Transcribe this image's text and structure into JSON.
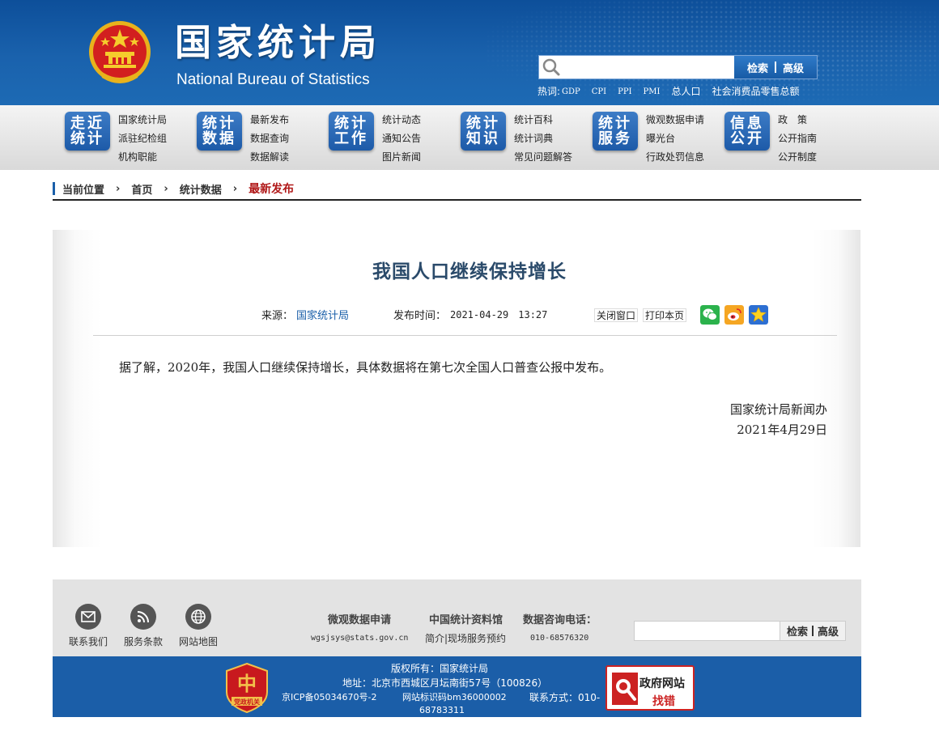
{
  "header": {
    "title_cn": "国家统计局",
    "title_en": "National Bureau of Statistics",
    "search": {
      "placeholder": "",
      "button": "检索",
      "advanced": "高级"
    },
    "hot": {
      "label": "热词:",
      "words": [
        "GDP",
        "CPI",
        "PPI",
        "PMI",
        "总人口",
        "社会消费品零售总额"
      ]
    }
  },
  "nav": [
    {
      "badge": [
        "走近",
        "统计"
      ],
      "links": [
        "国家统计局",
        "派驻纪检组",
        "机构职能"
      ]
    },
    {
      "badge": [
        "统计",
        "数据"
      ],
      "links": [
        "最新发布",
        "数据查询",
        "数据解读"
      ]
    },
    {
      "badge": [
        "统计",
        "工作"
      ],
      "links": [
        "统计动态",
        "通知公告",
        "图片新闻"
      ]
    },
    {
      "badge": [
        "统计",
        "知识"
      ],
      "links": [
        "统计百科",
        "统计词典",
        "常见问题解答"
      ]
    },
    {
      "badge": [
        "统计",
        "服务"
      ],
      "links": [
        "微观数据申请",
        "曝光台",
        "行政处罚信息"
      ]
    },
    {
      "badge": [
        "信息",
        "公开"
      ],
      "links": [
        "政　策",
        "公开指南",
        "公开制度"
      ]
    }
  ],
  "breadcrumb": {
    "label": "当前位置",
    "items": [
      "首页",
      "统计数据"
    ],
    "current": "最新发布",
    "separator": "›"
  },
  "article": {
    "title": "我国人口继续保持增长",
    "source_label": "来源：",
    "source": "国家统计局",
    "time_label": "发布时间：",
    "time": "2021-04-29　13:27",
    "close_window": "关闭窗口",
    "print_page": "打印本页",
    "body": "据了解，2020年，我国人口继续保持增长，具体数据将在第七次全国人口普查公报中发布。",
    "sign_org": "国家统计局新闻办",
    "sign_date": "2021年4月29日"
  },
  "footer": {
    "icons": [
      "联系我们",
      "服务条款",
      "网站地图"
    ],
    "col1": {
      "title": "微观数据申请",
      "text": "wgsjsys@stats.gov.cn"
    },
    "col2": {
      "title": "中国统计资料馆",
      "text": "简介|现场服务预约"
    },
    "col3": {
      "title": "数据咨询电话：",
      "text": "010-68576320"
    },
    "search": {
      "button": "检索",
      "advanced": "高级"
    },
    "bottom": {
      "copyright": "版权所有：国家统计局",
      "address": "地址：北京市西城区月坛南街57号（100826）",
      "icp": "京ICP备05034670号-2",
      "site_id": "网站标识码bm36000002",
      "contact": "联系方式：010-",
      "contact2": "68783311",
      "badge_text": "党政机关",
      "gov_check_1": "政府网站",
      "gov_check_2": "找错"
    }
  },
  "colors": {
    "brand_blue": "#1b5ea8",
    "accent_red": "#b01818",
    "title_blue": "#2a4a6a"
  }
}
